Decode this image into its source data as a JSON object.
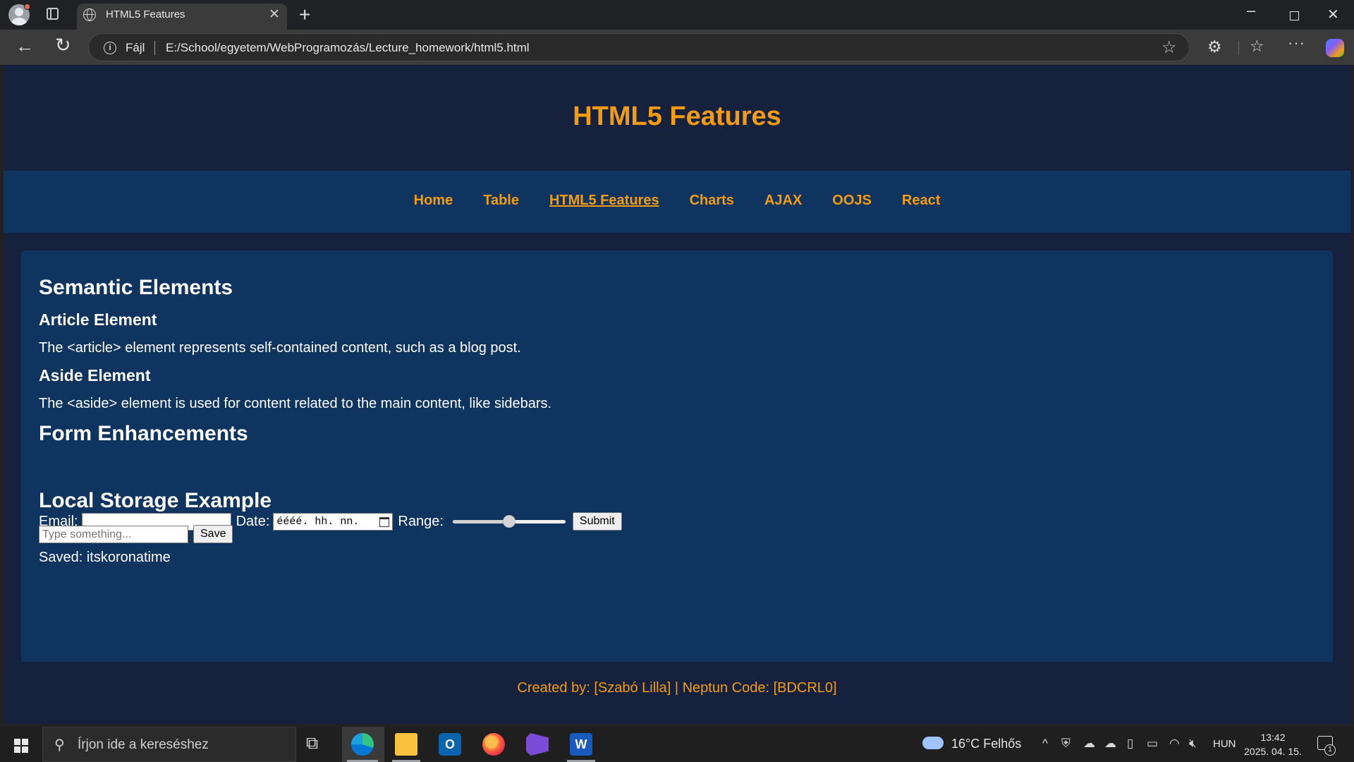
{
  "browser": {
    "tab_title": "HTML5 Features",
    "scheme_label": "Fájl",
    "url": "E:/School/egyetem/WebProgramozás/Lecture_homework/html5.html"
  },
  "page": {
    "header_title": "HTML5 Features",
    "nav": [
      {
        "label": "Home",
        "active": false
      },
      {
        "label": "Table",
        "active": false
      },
      {
        "label": "HTML5 Features",
        "active": true
      },
      {
        "label": "Charts",
        "active": false
      },
      {
        "label": "AJAX",
        "active": false
      },
      {
        "label": "OOJS",
        "active": false
      },
      {
        "label": "React",
        "active": false
      }
    ],
    "semantic_heading": "Semantic Elements",
    "article_heading": "Article Element",
    "article_text": "The <article> element represents self-contained content, such as a blog post.",
    "aside_heading": "Aside Element",
    "aside_text": "The <aside> element is used for content related to the main content, like sidebars.",
    "form_heading": "Form Enhancements",
    "email_label": "Email:",
    "email_value": "",
    "date_label": "Date:",
    "date_placeholder": "éééé. hh. nn.",
    "range_label": "Range:",
    "range_value": 0.5,
    "submit_label": "Submit",
    "storage_heading": "Local Storage Example",
    "storage_placeholder": "Type something...",
    "save_label": "Save",
    "saved_text": "Saved: itskoronatime",
    "footer_text": "Created by: [Szabó Lilla] | Neptun Code: [BDCRL0]"
  },
  "taskbar": {
    "search_placeholder": "Írjon ide a kereséshez",
    "weather": "16°C  Felhős",
    "language": "HUN",
    "time": "13:42",
    "date": "2025. 04. 15.",
    "notification_count": "1"
  },
  "colors": {
    "accent": "#f39c12",
    "header_bg": "#16213e",
    "nav_bg": "#0f3460",
    "card_bg": "#0f3460"
  }
}
